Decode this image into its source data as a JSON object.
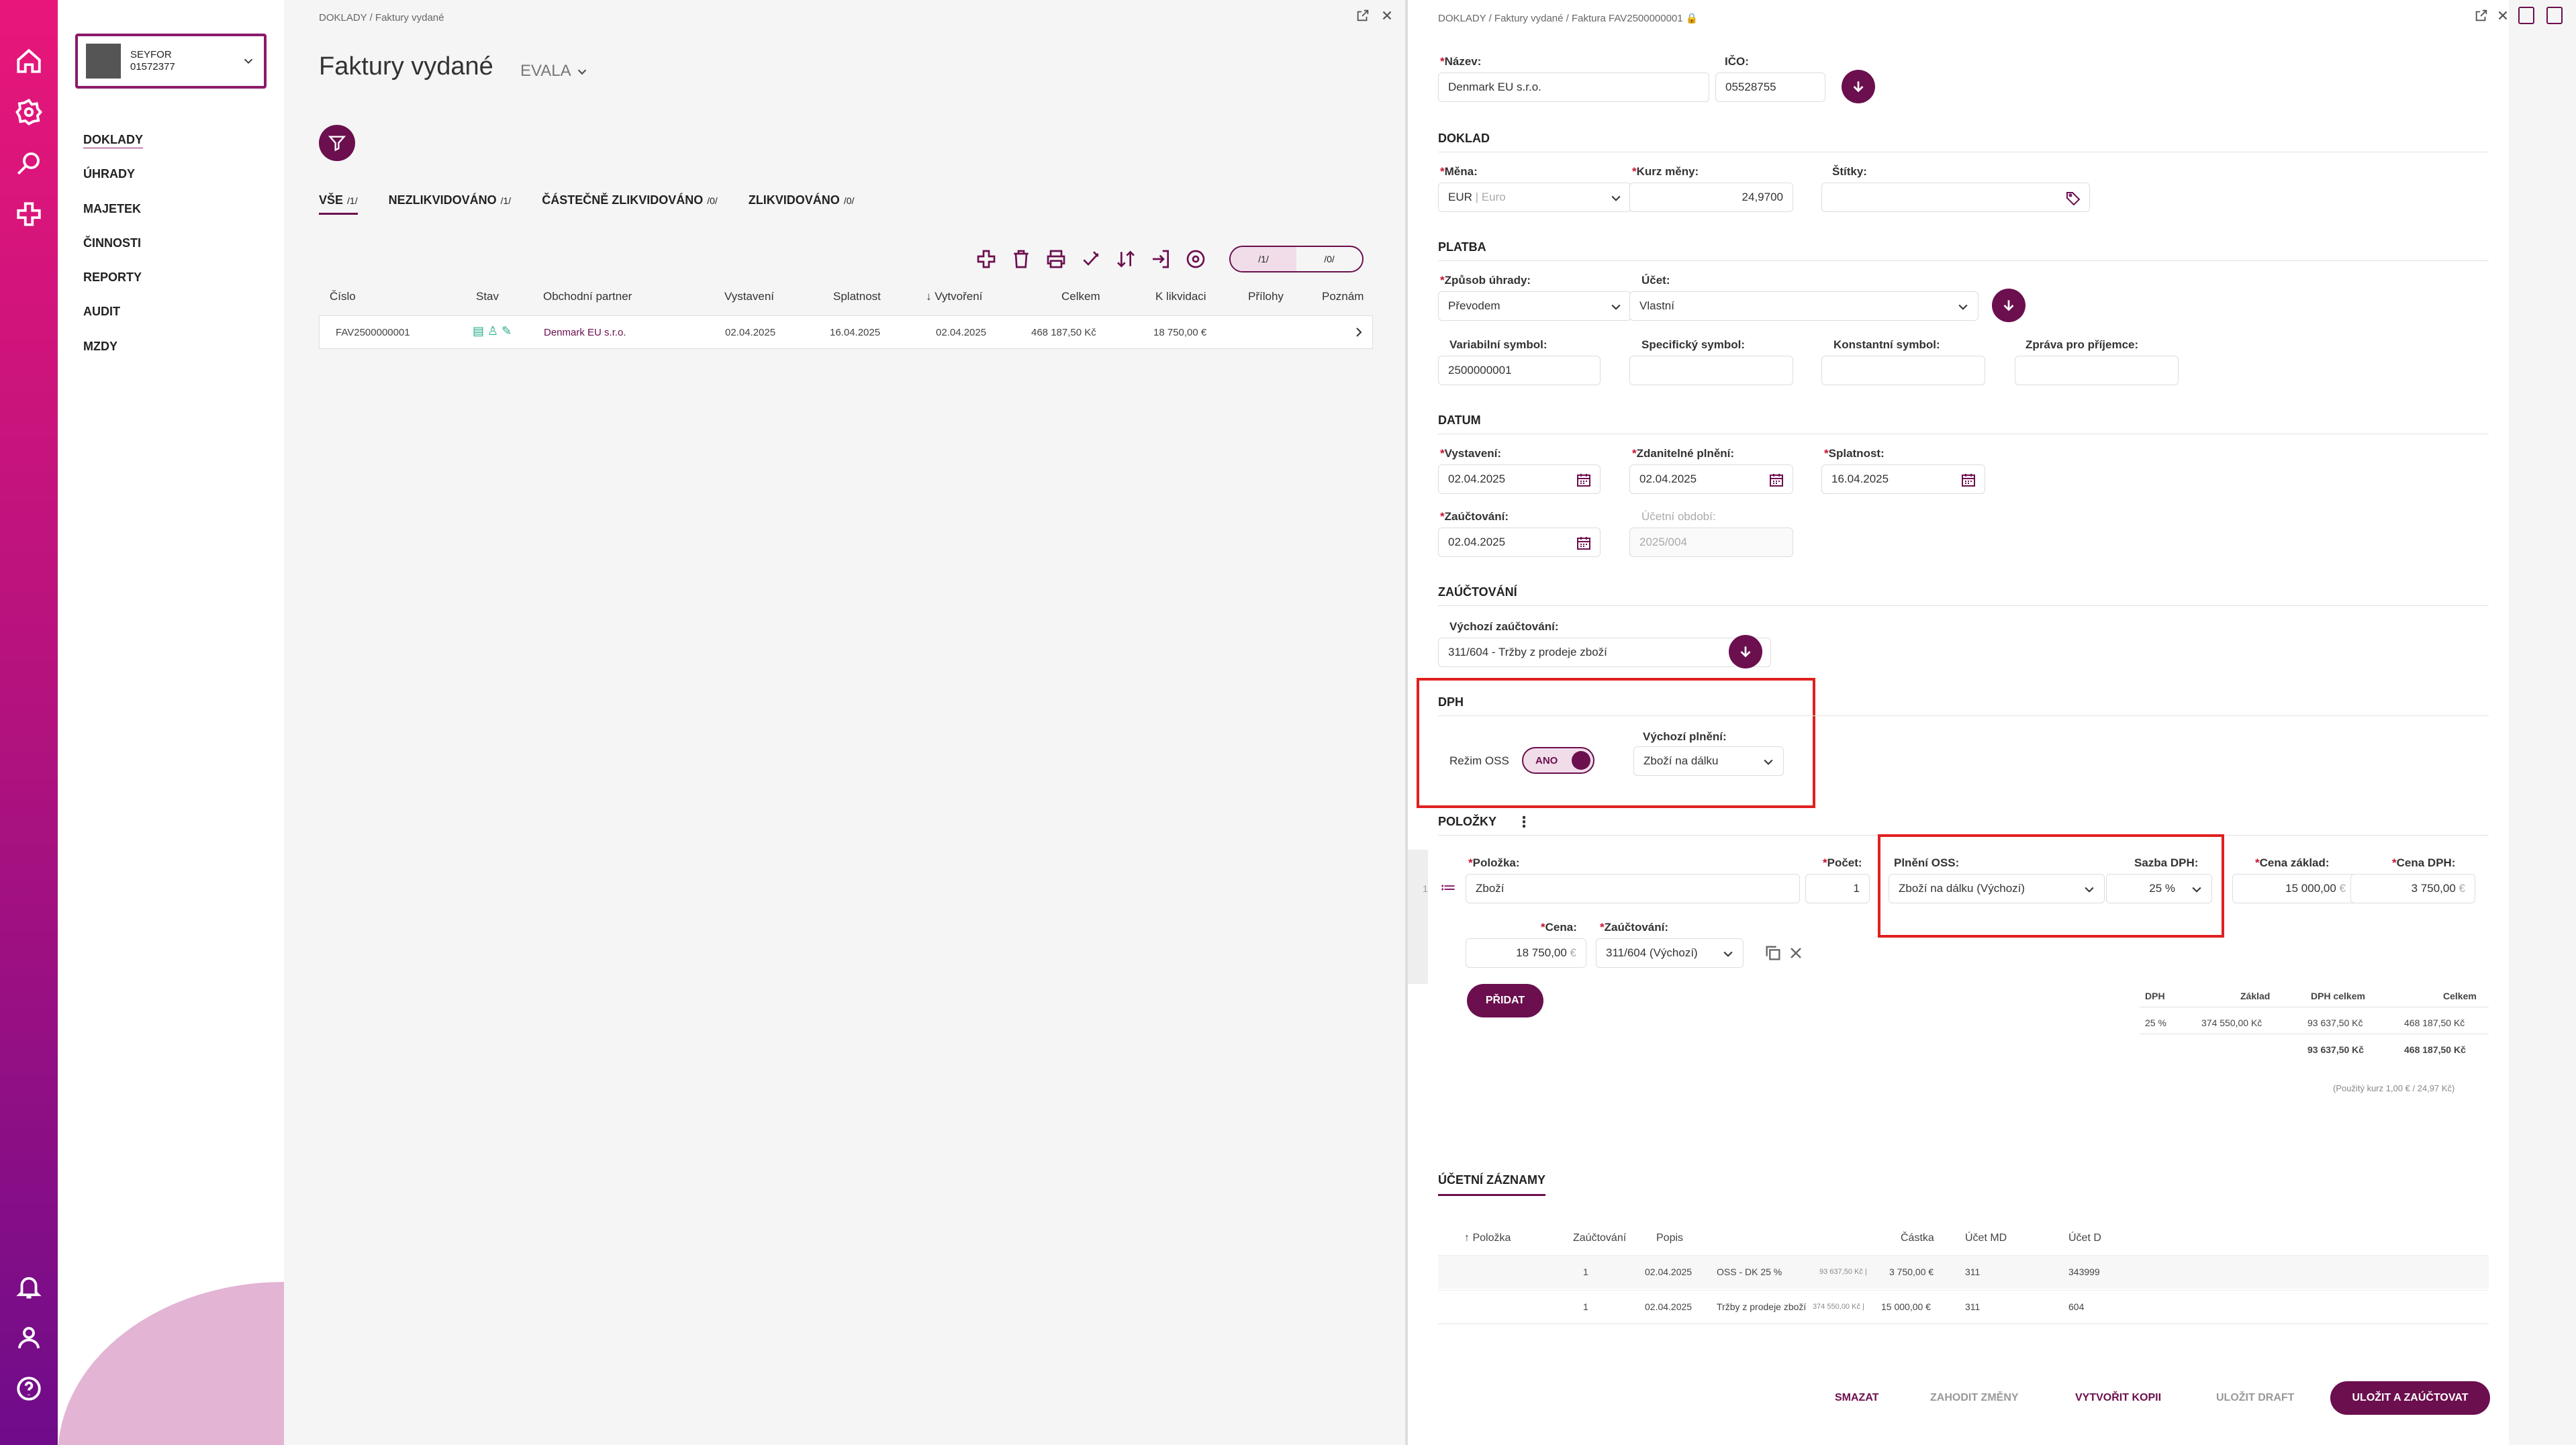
{
  "company": {
    "name": "SEYFOR",
    "id": "01572377"
  },
  "nav": [
    "DOKLADY",
    "ÚHRADY",
    "MAJETEK",
    "ČINNOSTI",
    "REPORTY",
    "AUDIT",
    "MZDY"
  ],
  "list": {
    "breadcrumb": "DOKLADY / Faktury vydané",
    "title": "Faktury vydané",
    "subtitle": "EVALA",
    "tabs": [
      {
        "label": "VŠE",
        "count": "/1/"
      },
      {
        "label": "NEZLIKVIDOVÁNO",
        "count": "/1/"
      },
      {
        "label": "ČÁSTEČNĚ ZLIKVIDOVÁNO",
        "count": "/0/"
      },
      {
        "label": "ZLIKVIDOVÁNO",
        "count": "/0/"
      }
    ],
    "view_counts": [
      "/1/",
      "/0/"
    ],
    "columns": [
      "Číslo",
      "Stav",
      "Obchodní partner",
      "Vystavení",
      "Splatnost",
      "↓ Vytvoření",
      "Celkem",
      "K likvidaci",
      "Přílohy",
      "Poznám"
    ],
    "row": {
      "number": "FAV2500000001",
      "partner": "Denmark EU s.r.o.",
      "issued": "02.04.2025",
      "due": "16.04.2025",
      "created": "02.04.2025",
      "total": "468 187,50 Kč",
      "to_settle": "18 750,00 €"
    }
  },
  "detail": {
    "breadcrumb": "DOKLADY / Faktury vydané / Faktura FAV2500000001",
    "name_label": "Název:",
    "name": "Denmark EU s.r.o.",
    "ico_label": "IČO:",
    "ico": "05528755",
    "sec_doklad": "DOKLAD",
    "mena_label": "Měna:",
    "mena": "EUR",
    "mena_desc": "| Euro",
    "kurz_label": "Kurz měny:",
    "kurz": "24,9700",
    "stitky_label": "Štítky:",
    "sec_platba": "PLATBA",
    "zpusob_label": "Způsob úhrady:",
    "zpusob": "Převodem",
    "ucet_label": "Účet:",
    "ucet": "Vlastní",
    "vs_label": "Variabilní symbol:",
    "vs": "2500000001",
    "ss_label": "Specifický symbol:",
    "ks_label": "Konstantní symbol:",
    "zprava_label": "Zpráva pro příjemce:",
    "sec_datum": "DATUM",
    "vyst_label": "Vystavení:",
    "vyst": "02.04.2025",
    "zdan_label": "Zdanitelné plnění:",
    "zdan": "02.04.2025",
    "splat_label": "Splatnost:",
    "splat": "16.04.2025",
    "zauct_label": "Zaúčtování:",
    "zauct": "02.04.2025",
    "obdobi_label": "Účetní období:",
    "obdobi": "2025/004",
    "sec_zauct": "ZAÚČTOVÁNÍ",
    "vych_zauct_label": "Výchozí zaúčtování:",
    "vych_zauct": "311/604 - Tržby z prodeje zboží",
    "sec_dph": "DPH",
    "oss_label": "Režim OSS",
    "oss_value": "ANO",
    "vych_plneni_label": "Výchozí plnění:",
    "vych_plneni": "Zboží na dálku",
    "sec_polozky": "POLOŽKY",
    "item": {
      "index": "1",
      "polozka_label": "Položka:",
      "polozka": "Zboží",
      "pocet_label": "Počet:",
      "pocet": "1",
      "plneni_label": "Plnění OSS:",
      "plneni": "Zboží na dálku (Výchozí)",
      "sazba_label": "Sazba DPH:",
      "sazba": "25 %",
      "zaklad_label": "Cena základ:",
      "zaklad": "15 000,00",
      "dph_label": "Cena DPH:",
      "dph": "3 750,00",
      "cena_label": "Cena:",
      "cena": "18 750,00",
      "zauct_label": "Zaúčtování:",
      "zauct": "311/604 (Výchozí)",
      "currency": "€"
    },
    "add_label": "PŘIDAT",
    "summary": {
      "headers": [
        "DPH",
        "Základ",
        "DPH celkem",
        "Celkem"
      ],
      "row": [
        "25 %",
        "374 550,00 Kč",
        "93 637,50 Kč",
        "468 187,50 Kč"
      ],
      "total": [
        "93 637,50 Kč",
        "468 187,50 Kč"
      ],
      "note": "(Použitý kurz 1,00 € / 24,97 Kč)"
    },
    "records_title": "ÚČETNÍ ZÁZNAMY",
    "records_headers": [
      "↑ Položka",
      "Zaúčtování",
      "Popis",
      "Částka",
      "Účet MD",
      "Účet D"
    ],
    "records": [
      {
        "pol": "1",
        "date": "02.04.2025",
        "desc": "OSS - DK 25 %",
        "amount_czk": "93 637,50 Kč |",
        "amount_eur": "3 750,00 €",
        "md": "311",
        "d": "343999"
      },
      {
        "pol": "1",
        "date": "02.04.2025",
        "desc": "Tržby z prodeje zboží",
        "amount_czk": "374 550,00 Kč |",
        "amount_eur": "15 000,00 €",
        "md": "311",
        "d": "604"
      }
    ],
    "buttons": {
      "delete": "SMAZAT",
      "discard": "ZAHODIT ZMĚNY",
      "copy": "VYTVOŘIT KOPII",
      "draft": "ULOŽIT DRAFT",
      "save": "ULOŽIT A ZAÚČTOVAT"
    }
  }
}
